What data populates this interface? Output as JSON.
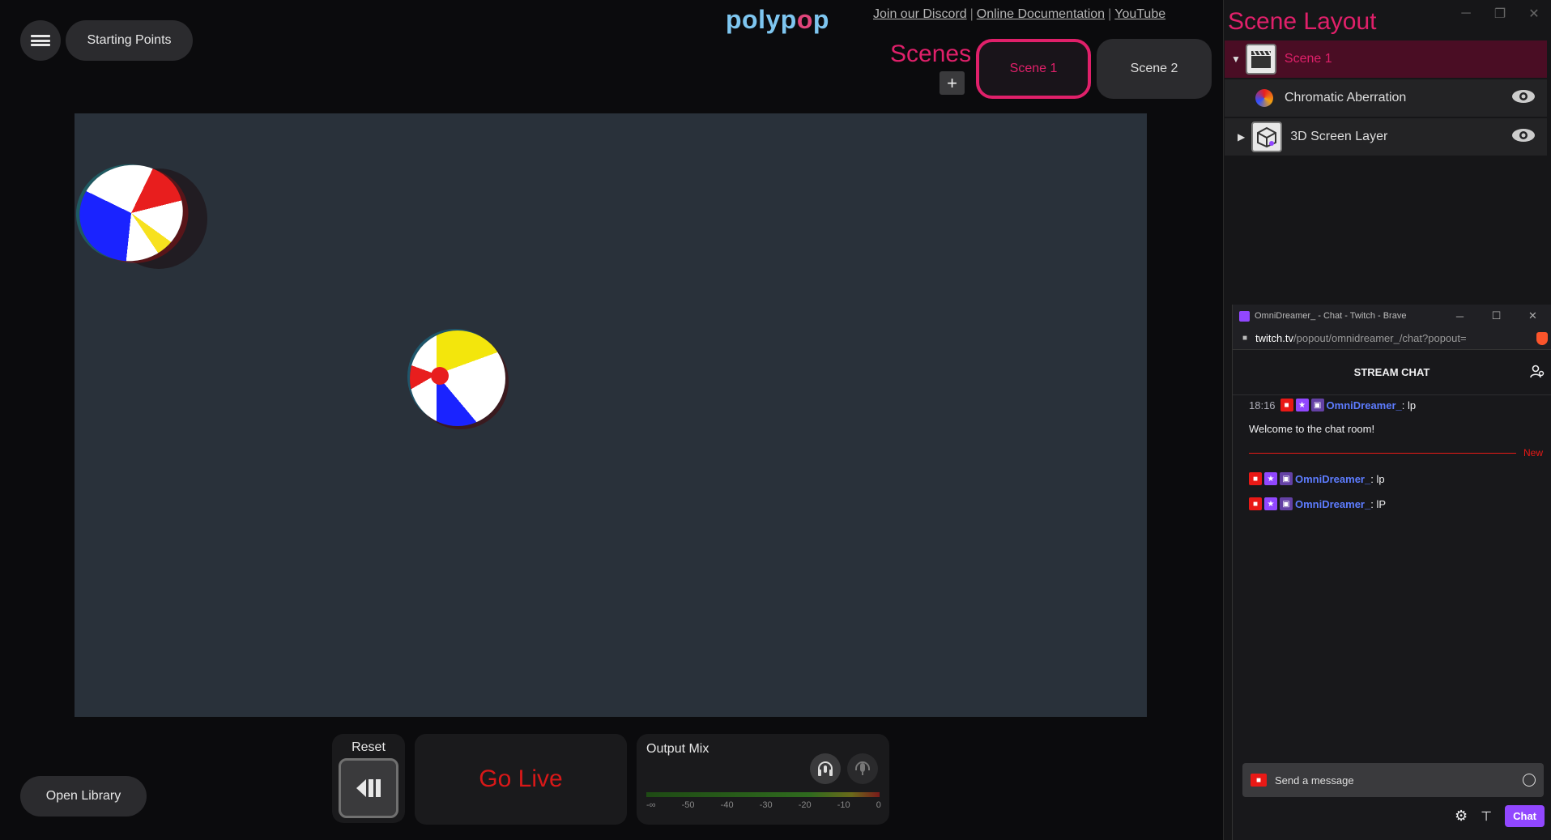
{
  "top_left": {
    "starting_points": "Starting Points"
  },
  "logo": {
    "text_a": "polyp",
    "text_b": "o",
    "text_c": "p"
  },
  "links": {
    "discord": "Join our Discord",
    "docs": "Online Documentation",
    "youtube": "YouTube",
    "separator": "|"
  },
  "scenes": {
    "title": "Scenes",
    "add": "+",
    "items": [
      "Scene 1",
      "Scene 2"
    ],
    "active": "Scene 1"
  },
  "controls": {
    "reset_label": "Reset",
    "go_live": "Go Live",
    "output_mix": "Output Mix",
    "ticks": [
      "-∞",
      "-50",
      "-40",
      "-30",
      "-20",
      "-10",
      "0"
    ]
  },
  "open_library": "Open Library",
  "scene_layout": {
    "title": "Scene Layout",
    "scene_row": "Scene 1",
    "layers": [
      {
        "label": "Chromatic Aberration"
      },
      {
        "label": "3D Screen Layer"
      }
    ]
  },
  "chat": {
    "window_title": "OmniDreamer_ - Chat - Twitch - Brave",
    "url_host": "twitch.tv",
    "url_path": "/popout/omnidreamer_/chat?popout=",
    "header": "STREAM CHAT",
    "messages": [
      {
        "time": "18:16",
        "user": "OmniDreamer_",
        "text": ": lp"
      },
      {
        "system": "Welcome to the chat room!"
      },
      {
        "user": "OmniDreamer_",
        "text": ": lp"
      },
      {
        "user": "OmniDreamer_",
        "text": ": lP"
      }
    ],
    "new_label": "New",
    "input_placeholder": "Send a message",
    "send_button": "Chat"
  },
  "colors": {
    "accent": "#e0206a",
    "twitch_purple": "#9147ff",
    "username": "#5d7cff"
  }
}
